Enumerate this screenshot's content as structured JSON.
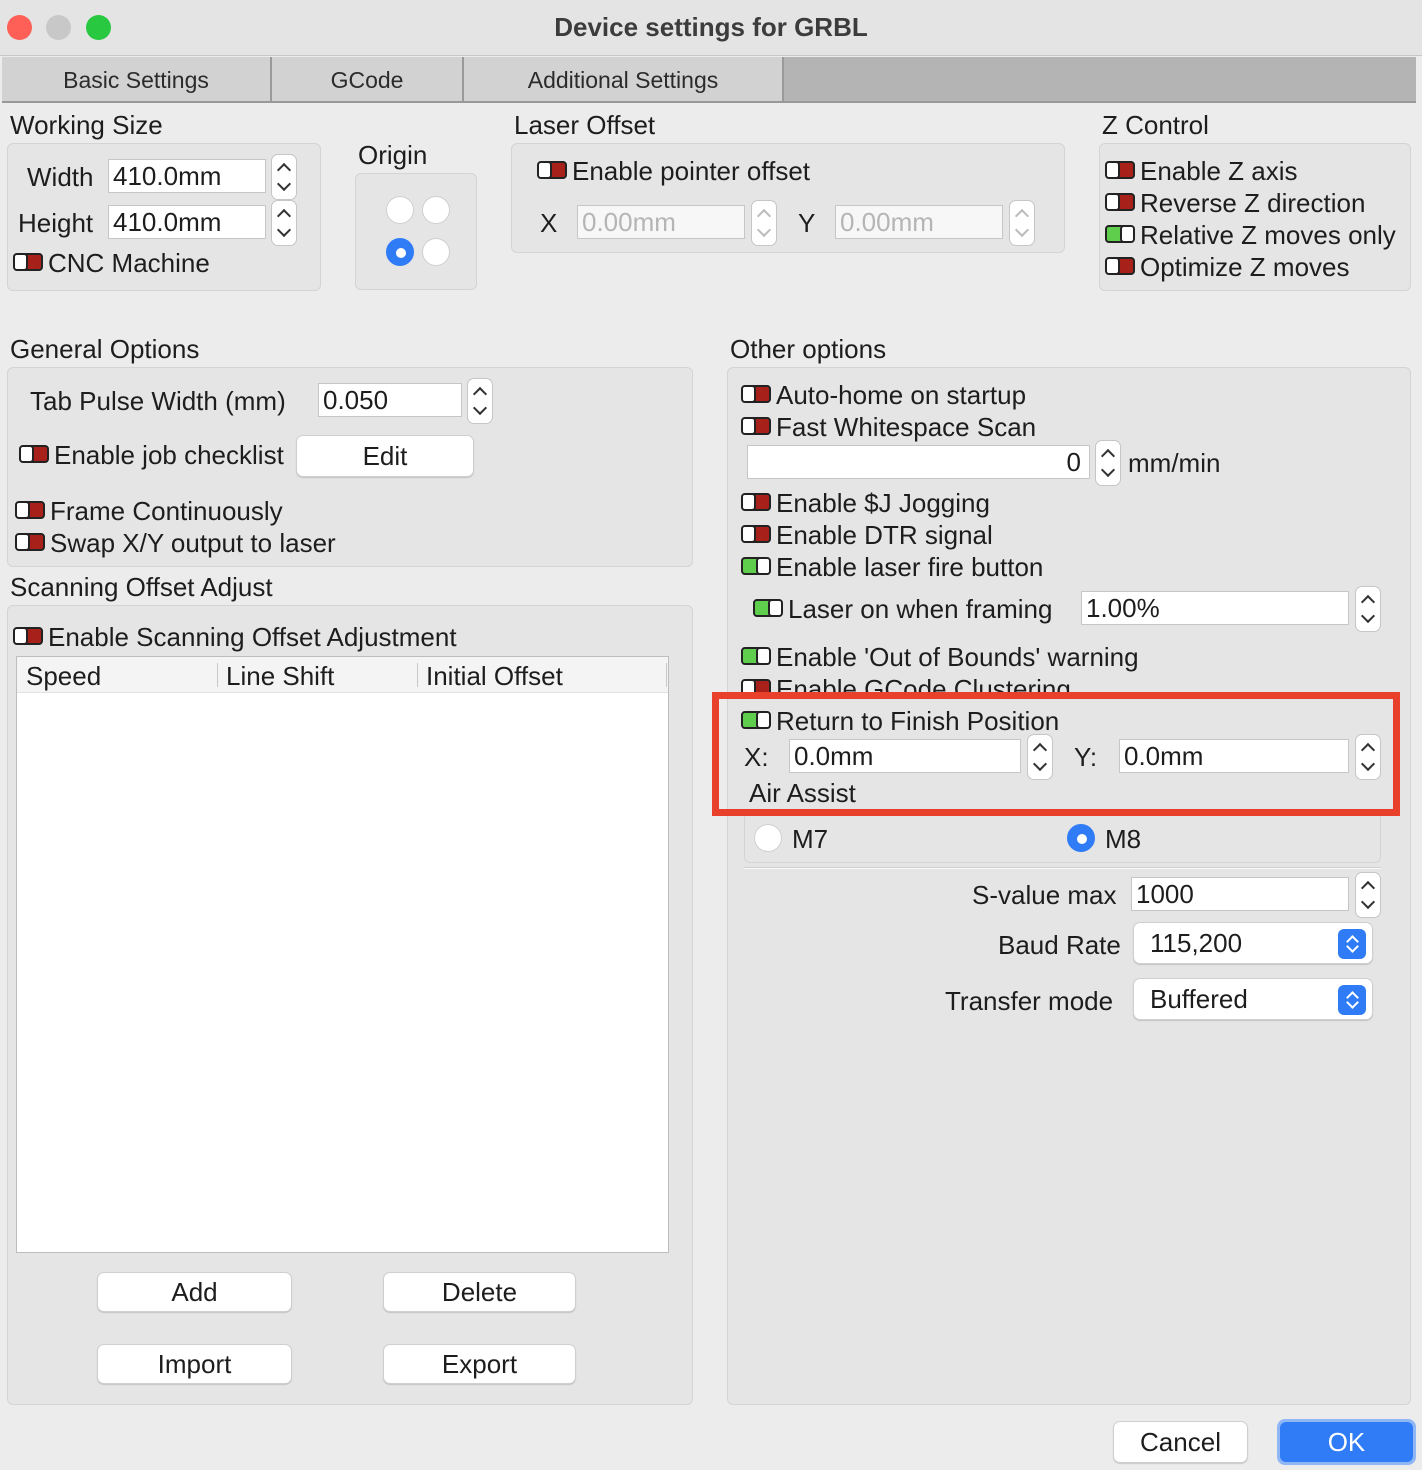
{
  "window": {
    "title": "Device settings for GRBL",
    "traffic_colors": [
      "#fe5f57",
      "#c8c8c8",
      "#28c840"
    ]
  },
  "tabs": [
    {
      "label": "Basic Settings"
    },
    {
      "label": "GCode"
    },
    {
      "label": "Additional Settings"
    }
  ],
  "working_size": {
    "heading": "Working Size",
    "width_label": "Width",
    "width_value": "410.0mm",
    "height_label": "Height",
    "height_value": "410.0mm",
    "cnc_label": "CNC Machine",
    "cnc_on": false
  },
  "origin": {
    "heading": "Origin",
    "selected": "bottom-left"
  },
  "laser_offset": {
    "heading": "Laser Offset",
    "enable_label": "Enable pointer offset",
    "enable_on": false,
    "x_label": "X",
    "x_value": "0.00mm",
    "y_label": "Y",
    "y_value": "0.00mm"
  },
  "z_control": {
    "heading": "Z Control",
    "items": [
      {
        "label": "Enable Z axis",
        "on": false
      },
      {
        "label": "Reverse Z direction",
        "on": false
      },
      {
        "label": "Relative Z moves only",
        "on": true
      },
      {
        "label": "Optimize Z moves",
        "on": false
      }
    ]
  },
  "general": {
    "heading": "General Options",
    "tab_pulse_label": "Tab Pulse Width (mm)",
    "tab_pulse_value": "0.050",
    "checklist_label": "Enable job checklist",
    "checklist_on": false,
    "edit_label": "Edit",
    "frame_label": "Frame Continuously",
    "frame_on": false,
    "swap_label": "Swap X/Y output to laser",
    "swap_on": false
  },
  "scanning": {
    "heading": "Scanning Offset Adjust",
    "enable_label": "Enable Scanning Offset Adjustment",
    "enable_on": false,
    "columns": [
      "Speed",
      "Line Shift",
      "Initial Offset"
    ],
    "add_label": "Add",
    "delete_label": "Delete",
    "import_label": "Import",
    "export_label": "Export"
  },
  "other": {
    "heading": "Other options",
    "autohome_label": "Auto-home on startup",
    "autohome_on": false,
    "fastscan_label": "Fast Whitespace Scan",
    "fastscan_on": false,
    "fastscan_value": "0",
    "fastscan_unit": "mm/min",
    "jogging_label": "Enable $J Jogging",
    "jogging_on": false,
    "dtr_label": "Enable DTR signal",
    "dtr_on": false,
    "fire_label": "Enable laser fire button",
    "fire_on": true,
    "framing_label": "Laser on when framing",
    "framing_on": true,
    "framing_value": "1.00%",
    "oob_label": "Enable 'Out of Bounds' warning",
    "oob_on": true,
    "clustering_label": "Enable GCode Clustering",
    "return_label": "Return to Finish Position",
    "return_on": true,
    "return_x_label": "X:",
    "return_x_value": "0.0mm",
    "return_y_label": "Y:",
    "return_y_value": "0.0mm",
    "air_assist_label": "Air Assist",
    "m7_label": "M7",
    "m8_label": "M8",
    "air_selected": "M8",
    "svalue_label": "S-value max",
    "svalue_value": "1000",
    "baud_label": "Baud Rate",
    "baud_value": "115,200",
    "transfer_label": "Transfer mode",
    "transfer_value": "Buffered"
  },
  "footer": {
    "cancel_label": "Cancel",
    "ok_label": "OK"
  },
  "colors": {
    "accent": "#2f7cf6",
    "toggle_on": "#5fce4c",
    "toggle_off": "#a8201a",
    "highlight": "#e8402a"
  }
}
